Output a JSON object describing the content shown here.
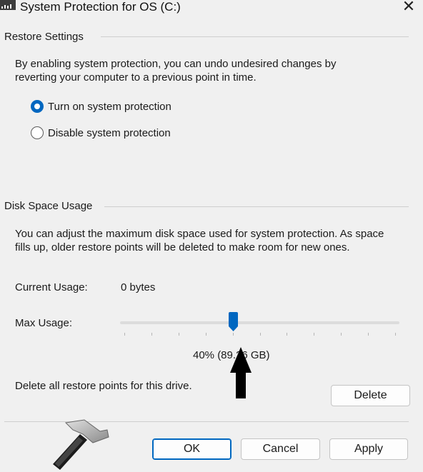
{
  "window": {
    "title": "System Protection for OS (C:)",
    "close_glyph": "✕"
  },
  "restore": {
    "group_title": "Restore Settings",
    "description_line1": "By enabling system protection, you can undo undesired changes by",
    "description_line2": "reverting your computer to a previous point in time.",
    "options": [
      {
        "label": "Turn on system protection",
        "selected": true
      },
      {
        "label": "Disable system protection",
        "selected": false
      }
    ]
  },
  "disk": {
    "group_title": "Disk Space Usage",
    "description_line1": "You can adjust the maximum disk space used for system protection. As space",
    "description_line2": "fills up, older restore points will be deleted to make room for new ones.",
    "current_usage_label": "Current Usage:",
    "current_usage_value": "0 bytes",
    "max_usage_label": "Max Usage:",
    "max_usage_fraction": 0.4,
    "max_usage_value_text": "40% (89.26 GB)",
    "delete_text": "Delete all restore points for this drive.",
    "delete_button": "Delete"
  },
  "footer": {
    "ok": "OK",
    "cancel": "Cancel",
    "apply": "Apply"
  },
  "colors": {
    "accent": "#0067c0",
    "background": "#f0f0f0"
  },
  "icons": [
    "window-icon",
    "close-icon",
    "arrow-up-icon",
    "hammer-logo-icon"
  ]
}
